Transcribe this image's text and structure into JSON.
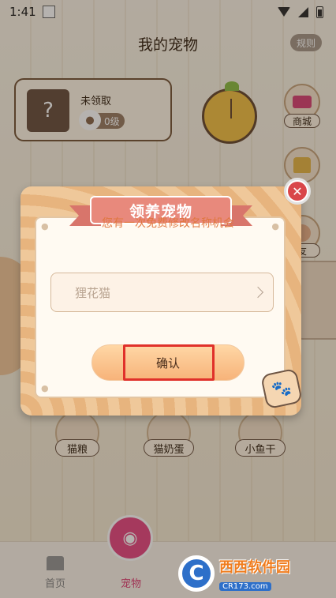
{
  "status_bar": {
    "time": "1:41"
  },
  "header": {
    "title": "我的宠物",
    "rules_label": "规则"
  },
  "pet_card": {
    "placeholder_mark": "?",
    "status": "未领取",
    "level": "0级"
  },
  "side_menu": [
    {
      "label": "商城",
      "icon": "shop-basket-icon"
    },
    {
      "label": "",
      "icon": "shirt-icon"
    },
    {
      "label": "友",
      "icon": "friend-avatar-icon"
    }
  ],
  "food": [
    {
      "label": "猫粮"
    },
    {
      "label": "猫奶蛋"
    },
    {
      "label": "小鱼干"
    }
  ],
  "tabs": [
    {
      "label": "首页",
      "icon": "home-icon",
      "active": false
    },
    {
      "label": "宠物",
      "icon": "cat-face-icon",
      "active": true
    }
  ],
  "dialog": {
    "title": "领养宠物",
    "subtitle": "您有一次免费修改名称机会",
    "name_value": "狸花猫",
    "confirm_label": "确认",
    "close_mark": "✕",
    "paw_mark": "🐾"
  },
  "colors": {
    "accent_pink": "#e84d86",
    "ribbon": "#e8897c",
    "subtitle_orange": "#e07740",
    "highlight_red": "#e0302a"
  },
  "watermark": {
    "logo_letter": "C",
    "title": "西西软件园",
    "url": "CR173.com"
  }
}
